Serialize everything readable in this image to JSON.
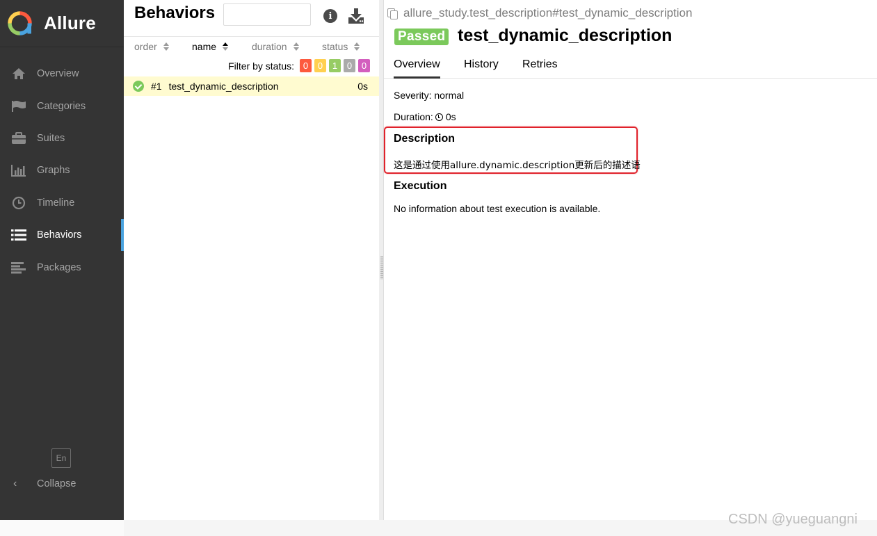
{
  "app": {
    "name": "Allure",
    "logo_colors": [
      "#fd5a3e",
      "#ffd050",
      "#97cc64",
      "#4aa3df"
    ]
  },
  "sidebar": {
    "items": [
      {
        "label": "Overview",
        "icon": "home-icon",
        "active": false
      },
      {
        "label": "Categories",
        "icon": "flag-icon",
        "active": false
      },
      {
        "label": "Suites",
        "icon": "briefcase-icon",
        "active": false
      },
      {
        "label": "Graphs",
        "icon": "bar-chart-icon",
        "active": false
      },
      {
        "label": "Timeline",
        "icon": "clock-icon",
        "active": false
      },
      {
        "label": "Behaviors",
        "icon": "list-icon",
        "active": true
      },
      {
        "label": "Packages",
        "icon": "align-left-icon",
        "active": false
      }
    ],
    "language": "En",
    "collapse_label": "Collapse",
    "collapse_icon": "chevron-left-icon"
  },
  "list": {
    "title": "Behaviors",
    "search": {
      "value": "",
      "placeholder": ""
    },
    "columns": {
      "order": "order",
      "name": "name",
      "duration": "duration",
      "status": "status"
    },
    "active_sort": "name",
    "filter_label": "Filter by status:",
    "status_counts": [
      {
        "status": "failed",
        "count": "0",
        "color": "#fd5a3e"
      },
      {
        "status": "broken",
        "count": "0",
        "color": "#ffd050"
      },
      {
        "status": "passed",
        "count": "1",
        "color": "#97cc64"
      },
      {
        "status": "skipped",
        "count": "0",
        "color": "#aaaaaa"
      },
      {
        "status": "unknown",
        "count": "0",
        "color": "#d35ebe"
      }
    ],
    "rows": [
      {
        "order": "#1",
        "name": "test_dynamic_description",
        "duration": "0s",
        "status": "passed",
        "status_icon": "check-circle-icon"
      }
    ]
  },
  "detail": {
    "full_name": "allure_study.test_description#test_dynamic_description",
    "status_badge": "Passed",
    "title": "test_dynamic_description",
    "tabs": [
      {
        "label": "Overview",
        "active": true
      },
      {
        "label": "History",
        "active": false
      },
      {
        "label": "Retries",
        "active": false
      }
    ],
    "severity_text": "Severity: normal",
    "duration_label": "Duration:",
    "duration_value": "0s",
    "description_heading": "Description",
    "description_text": "这是通过使用allure.dynamic.description更新后的描述语",
    "execution_heading": "Execution",
    "execution_text": "No information about test execution is available."
  },
  "watermark": "CSDN @yueguangni",
  "colors": {
    "sidebar_bg": "#343434",
    "accent": "#4aa3df",
    "passed": "#7bc95b",
    "selected_row": "#fffbd0",
    "highlight_border": "#e0222b"
  }
}
